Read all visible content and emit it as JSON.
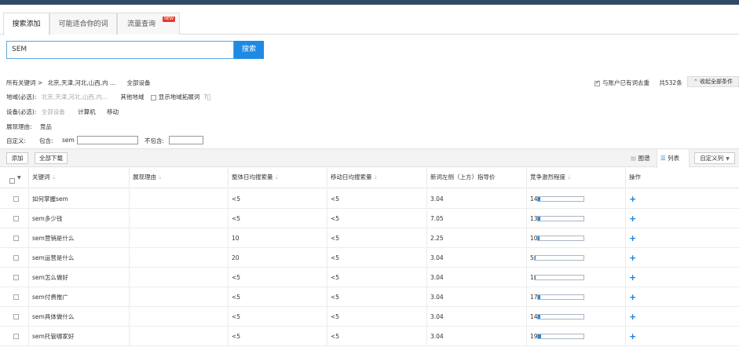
{
  "tabs": [
    {
      "label": "搜索添加"
    },
    {
      "label": "可能适合你的词"
    },
    {
      "label": "流量查询",
      "badge": "NEW"
    }
  ],
  "search": {
    "value": "SEM",
    "button_label": "搜索"
  },
  "filters": {
    "summary_all": "所有关键词 >",
    "summary_region": "北京,天津,河北,山西,内 ...",
    "summary_device": "全部设备",
    "exclude_label": "与账户已有词去重",
    "total_count": "共532条",
    "collapse_label": "收起全部条件",
    "region_label": "地域(必选):",
    "region_value": "北京,天津,河北,山西,内...",
    "other_region": "其他地域",
    "show_expand": "显示地域拓展词",
    "device_label": "设备(必选):",
    "device_all": "全部设备",
    "device_pc": "计算机",
    "device_mobile": "移动",
    "reason_label": "展现理由:",
    "reason_value": "竞品",
    "custom_label": "自定义:",
    "include_label": "包含:",
    "include_value": "sem",
    "exclude_kw_label": "不包含:"
  },
  "toolbar": {
    "add_label": "添加",
    "download_label": "全部下载",
    "view_chart": "图谱",
    "view_list": "列表",
    "custom_cols": "自定义列"
  },
  "table": {
    "headers": [
      "关键词",
      "展现理由",
      "整体日均搜索量",
      "移动日均搜索量",
      "新词左侧（上方）指导价",
      "竞争激烈程度",
      "操作"
    ],
    "rows": [
      {
        "keyword": "如何掌握sem",
        "reason": "",
        "total": "<5",
        "mobile": "<5",
        "price": "3.04",
        "competition": "14",
        "level": 0.14
      },
      {
        "keyword": "sem多少钱",
        "reason": "",
        "total": "<5",
        "mobile": "<5",
        "price": "7.05",
        "competition": "13",
        "level": 0.13
      },
      {
        "keyword": "sem营销是什么",
        "reason": "",
        "total": "10",
        "mobile": "<5",
        "price": "2.25",
        "competition": "10",
        "level": 0.1
      },
      {
        "keyword": "sem运营是什么",
        "reason": "",
        "total": "20",
        "mobile": "<5",
        "price": "3.04",
        "competition": "5",
        "level": 0.05
      },
      {
        "keyword": "sem怎么做好",
        "reason": "",
        "total": "<5",
        "mobile": "<5",
        "price": "3.04",
        "competition": "1",
        "level": 0.01
      },
      {
        "keyword": "sem付费推广",
        "reason": "",
        "total": "<5",
        "mobile": "<5",
        "price": "3.04",
        "competition": "17",
        "level": 0.17
      },
      {
        "keyword": "sem具体做什么",
        "reason": "",
        "total": "<5",
        "mobile": "<5",
        "price": "3.04",
        "competition": "14",
        "level": 0.14
      },
      {
        "keyword": "sem托管哪家好",
        "reason": "",
        "total": "<5",
        "mobile": "<5",
        "price": "3.04",
        "competition": "19",
        "level": 0.19
      }
    ],
    "action_glyph": "+"
  },
  "colors": {
    "accent": "#1e8ae6",
    "topbar": "#2f4b66",
    "bar_fill": "#2b87db"
  }
}
